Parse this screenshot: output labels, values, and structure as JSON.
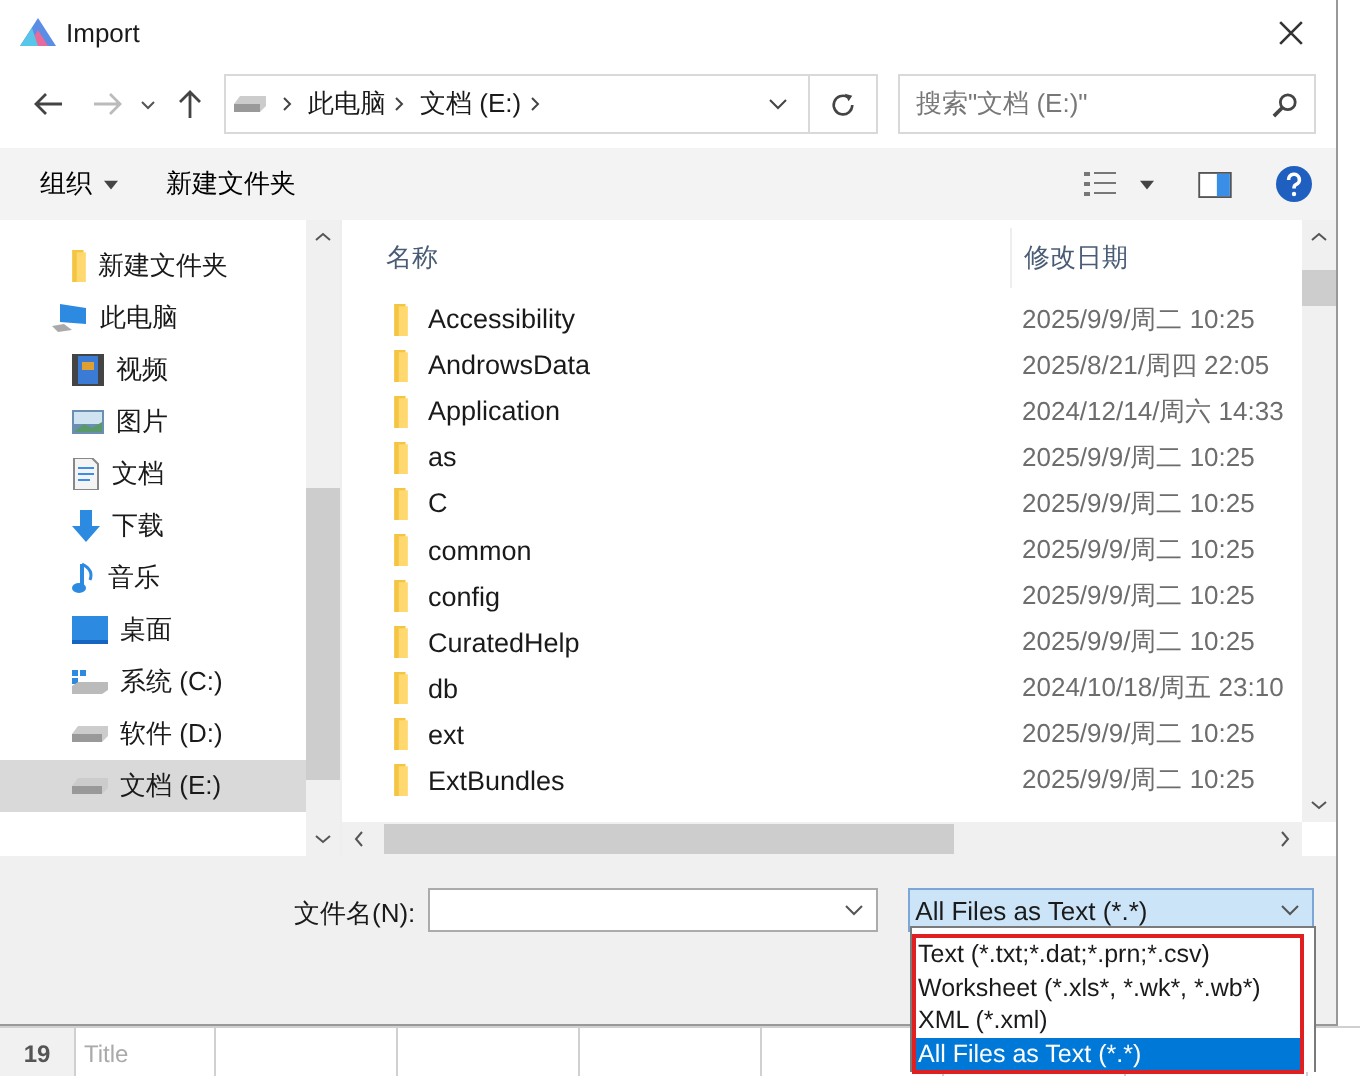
{
  "window": {
    "title": "Import"
  },
  "address": {
    "crumbs": [
      "此电脑",
      "文档 (E:)"
    ],
    "search_placeholder": "搜索\"文档 (E:)\""
  },
  "toolbar": {
    "organize": "组织",
    "new_folder": "新建文件夹"
  },
  "sidebar": {
    "items": [
      {
        "label": "新建文件夹",
        "kind": "folder",
        "selected": false
      },
      {
        "label": "此电脑",
        "kind": "pc",
        "selected": false,
        "children": [
          {
            "label": "视频",
            "kind": "video",
            "selected": false
          },
          {
            "label": "图片",
            "kind": "pictures",
            "selected": false
          },
          {
            "label": "文档",
            "kind": "documents",
            "selected": false
          },
          {
            "label": "下载",
            "kind": "downloads",
            "selected": false
          },
          {
            "label": "音乐",
            "kind": "music",
            "selected": false
          },
          {
            "label": "桌面",
            "kind": "desktop",
            "selected": false
          },
          {
            "label": "系统 (C:)",
            "kind": "system-drive",
            "selected": false
          },
          {
            "label": "软件 (D:)",
            "kind": "drive",
            "selected": false
          },
          {
            "label": "文档 (E:)",
            "kind": "drive",
            "selected": true
          }
        ]
      }
    ]
  },
  "table": {
    "columns": [
      "名称",
      "修改日期"
    ],
    "rows": [
      {
        "name": "Accessibility",
        "modified": "2025/9/9/周二 10:25"
      },
      {
        "name": "AndrowsData",
        "modified": "2025/8/21/周四 22:05"
      },
      {
        "name": "Application",
        "modified": "2024/12/14/周六 14:33"
      },
      {
        "name": "as",
        "modified": "2025/9/9/周二 10:25"
      },
      {
        "name": "C",
        "modified": "2025/9/9/周二 10:25"
      },
      {
        "name": "common",
        "modified": "2025/9/9/周二 10:25"
      },
      {
        "name": "config",
        "modified": "2025/9/9/周二 10:25"
      },
      {
        "name": "CuratedHelp",
        "modified": "2025/9/9/周二 10:25"
      },
      {
        "name": "db",
        "modified": "2024/10/18/周五 23:10"
      },
      {
        "name": "ext",
        "modified": "2025/9/9/周二 10:25"
      },
      {
        "name": "ExtBundles",
        "modified": "2025/9/9/周二 10:25"
      }
    ]
  },
  "file_name": {
    "label": "文件名(N):"
  },
  "file_type": {
    "value": "All Files as Text (*.*)",
    "options": [
      {
        "label": "Text (*.txt;*.dat;*.prn;*.csv)",
        "selected": false
      },
      {
        "label": "Worksheet (*.xls*, *.wk*, *.wb*)",
        "selected": false
      },
      {
        "label": "XML (*.xml)",
        "selected": false
      },
      {
        "label": "All Files as Text (*.*)",
        "selected": true
      }
    ]
  },
  "background_sheet": {
    "row_number": "19",
    "cell": "Title"
  }
}
